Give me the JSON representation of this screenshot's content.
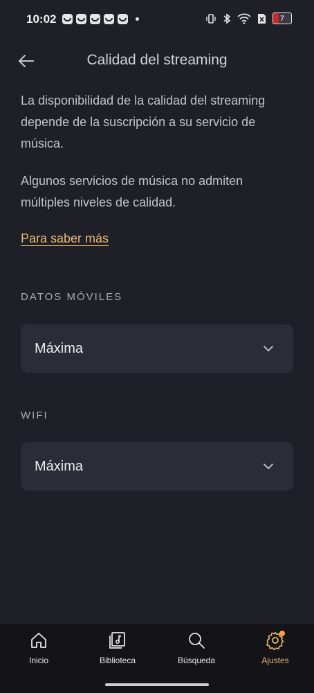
{
  "status_bar": {
    "time": "10:02",
    "battery_level": "7",
    "icons": [
      "notification-app-icon",
      "vibrate-icon",
      "bluetooth-icon",
      "wifi-icon",
      "no-sim-icon",
      "battery-icon"
    ]
  },
  "header": {
    "title": "Calidad del streaming",
    "back_icon": "arrow-left-icon"
  },
  "content": {
    "description_1": "La disponibilidad de la calidad del streaming depende de la suscripción a su servicio de música.",
    "description_2": "Algunos servicios de música no admiten múltiples niveles de calidad.",
    "learn_more": "Para saber más",
    "mobile_data": {
      "label": "DATOS MÓVILES",
      "value": "Máxima"
    },
    "wifi": {
      "label": "WIFI",
      "value": "Máxima"
    }
  },
  "bottom_nav": {
    "items": [
      {
        "label": "Inicio",
        "icon": "home-icon"
      },
      {
        "label": "Biblioteca",
        "icon": "library-icon"
      },
      {
        "label": "Búsqueda",
        "icon": "search-icon"
      },
      {
        "label": "Ajustes",
        "icon": "gear-icon",
        "active": true
      }
    ]
  },
  "colors": {
    "background": "#1f1f28",
    "accent": "#e8b873",
    "select_bg": "#2c2c36",
    "nav_bg": "#131318",
    "battery_low": "#c42b2b"
  }
}
